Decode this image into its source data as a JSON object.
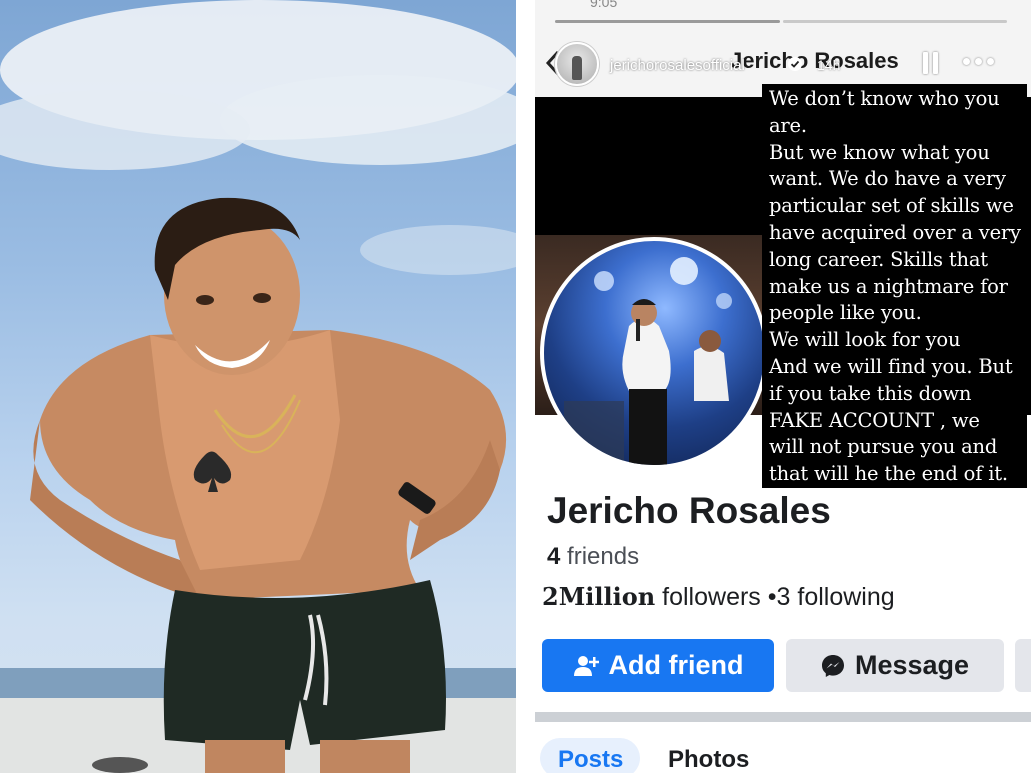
{
  "story": {
    "status_time": "9:05",
    "handle": "jerichorosalesofficial",
    "time_ago": "14h",
    "caption_lines": [
      "We don’t know who you",
      "are.",
      "But we know what you",
      "want. We do have a very",
      "particular set of skills we",
      "have acquired over a very",
      "long career. Skills that",
      "make us a nightmare for",
      "people like you.",
      "We will look for you",
      "And we will find you. But",
      "if you take this down",
      "FAKE ACCOUNT , we",
      "will not pursue you and",
      "that will he the end of it."
    ]
  },
  "profile": {
    "header_name": "Jericho Rosales",
    "name": "Jericho Rosales",
    "friends_count": "4",
    "friends_label": "friends",
    "followers_count": "2Million",
    "followers_label": "followers",
    "separator": "•",
    "following_count": "3",
    "following_label": "following"
  },
  "actions": {
    "add_friend": "Add friend",
    "message": "Message"
  },
  "tabs": {
    "posts": "Posts",
    "photos": "Photos"
  },
  "colors": {
    "facebook_blue": "#1877f2",
    "secondary_button": "#e4e6eb"
  },
  "icons": [
    "back-icon",
    "verified-icon",
    "pause-icon",
    "more-icon",
    "add-person-icon",
    "messenger-icon"
  ]
}
